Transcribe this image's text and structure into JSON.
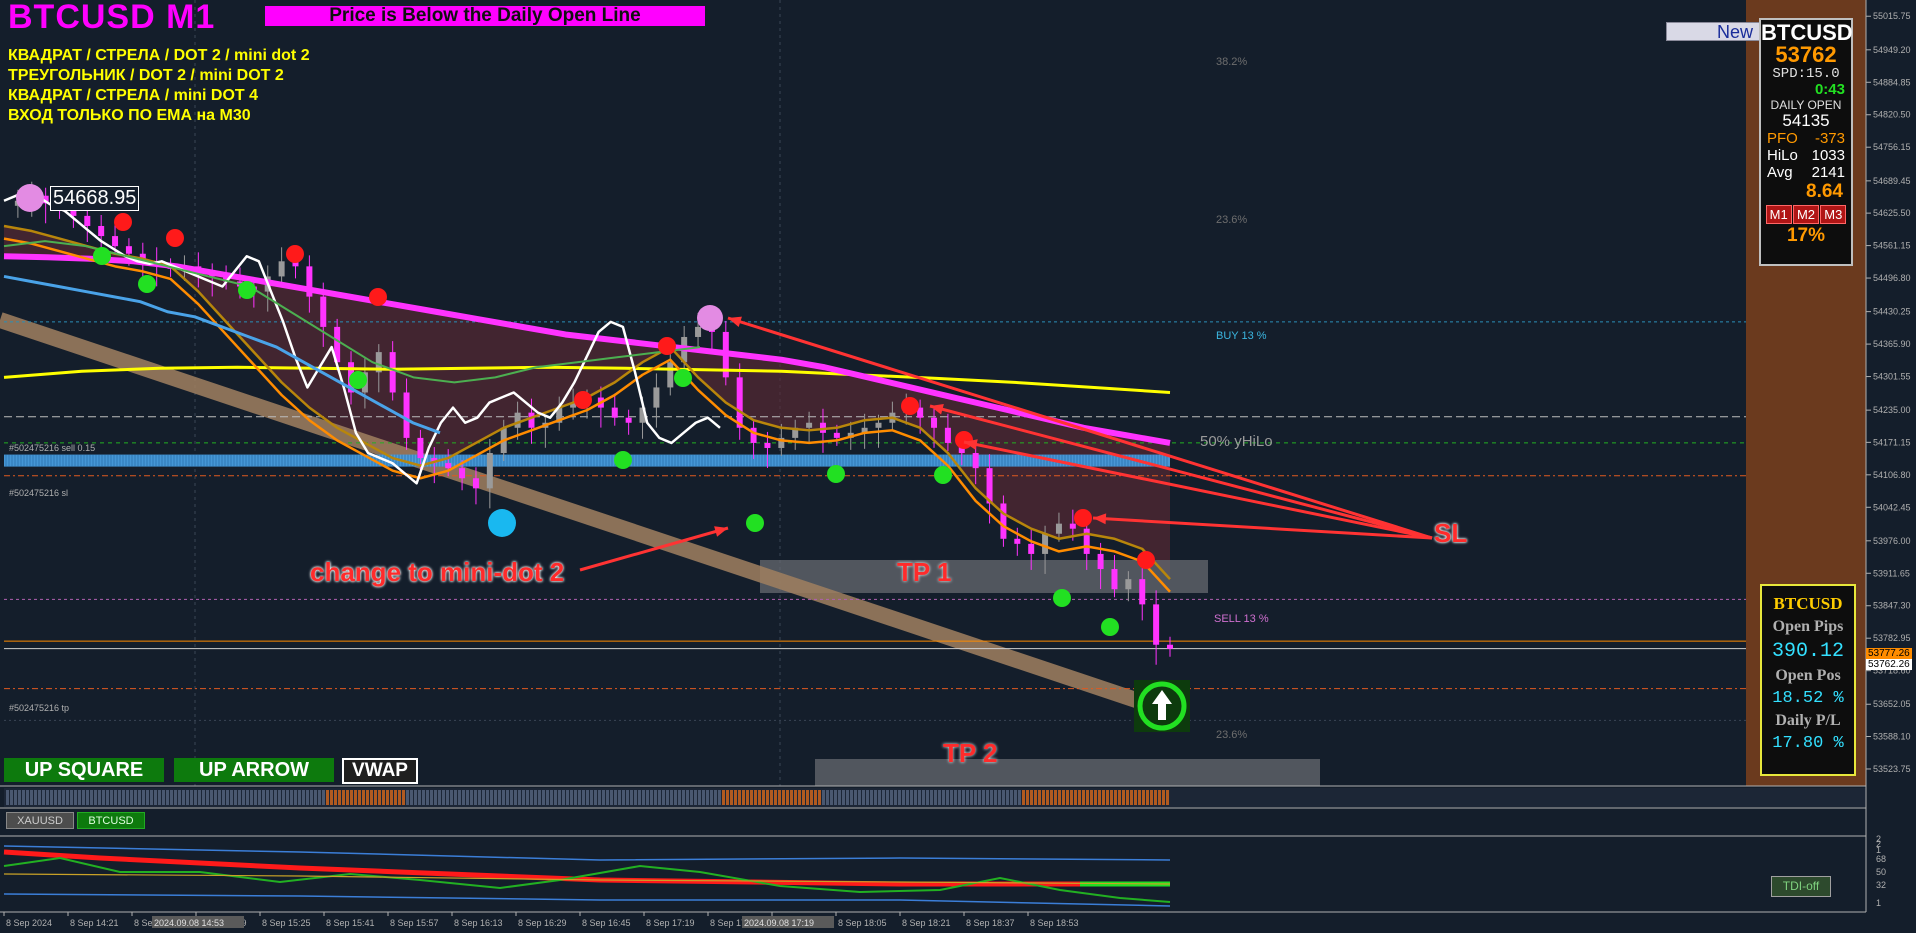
{
  "header": {
    "symbol_title": "BTCUSD M1",
    "banner": "Price is Below the Daily Open Line",
    "new_button": "New",
    "price_tag": "54668.95"
  },
  "strategy_notes": [
    "КВАДРАТ / СТРЕЛА / DOT 2 / mini dot 2",
    "ТРЕУГОЛЬНИК / DOT 2 / mini DOT 2",
    "КВАДРАТ / СТРЕЛА /  mini DOT 4",
    "ВХОД ТОЛЬКО ПО ЕМА на  M30"
  ],
  "info_panel": {
    "symbol": "BTCUSD",
    "price": "53762",
    "spread": "SPD:15.0",
    "timer": "0:43",
    "daily_open_label": "DAILY OPEN",
    "daily_open": "54135",
    "pfo_label": "PFO",
    "pfo": "-373",
    "hilo_label": "HiLo",
    "hilo": "1033",
    "avg_label": "Avg",
    "avg": "2141",
    "ratio": "8.64",
    "tf_buttons": [
      "M1",
      "M2",
      "M3"
    ],
    "percent": "17%"
  },
  "pips_panel": {
    "symbol": "BTCUSD",
    "open_pips_label": "Open Pips",
    "open_pips": "390.12",
    "open_pos_label": "Open Pos",
    "open_pos": "18.52 %",
    "daily_pl_label": "Daily P/L",
    "daily_pl": "17.80 %"
  },
  "buttons": {
    "up_square": "UP SQUARE",
    "up_arrow": "UP ARROW",
    "vwap": "VWAP",
    "tdi": "TDI-off"
  },
  "symbol_tabs": [
    "XAUUSD",
    "BTCUSD"
  ],
  "annotations": {
    "change_note": "change to mini-dot 2",
    "sl": "SL",
    "tp1": "TP 1",
    "tp2": "TP 2"
  },
  "level_labels": {
    "fib_top": "38.2%",
    "fib_mid": "23.6%",
    "buy": "BUY 13 %",
    "hilo50": "50% yHiLo",
    "sell": "SELL 13 %",
    "fib_bottom": "23.6%",
    "order_sell": "#502475216 sell 0.15",
    "order_sl": "#502475216 sl",
    "order_tp": "#502475216 tp",
    "price_box_1": "53777.26",
    "price_box_2": "53762.26"
  },
  "colors": {
    "background": "#141e2b",
    "bear_candles": "#ff33ff",
    "bull_candles": "#9a9a9a",
    "ema_fast": "#ff8c00",
    "ema_mid": "#b8860b",
    "ema_slow": "#ff33ff",
    "ema_200": "#ffff00",
    "daily_open_band": "#4aa3e8",
    "trendline": "#a08060",
    "dot_red": "#ff1a1a",
    "dot_green": "#22e022",
    "dot_violet": "#e38be3"
  },
  "chart_data": {
    "type": "line",
    "title": "BTCUSD M1",
    "x_ticks": [
      "8 Sep 2024",
      "8 Sep 14:21",
      "8 Sep 14:53",
      "8 Sep 15:09",
      "8 Sep 15:25",
      "8 Sep 15:41",
      "8 Sep 15:57",
      "8 Sep 16:13",
      "8 Sep 16:29",
      "8 Sep 16:45",
      "8 Sep 17:19",
      "8 Sep 17:33",
      "8 Sep 17:49",
      "8 Sep 18:05",
      "8 Sep 18:21",
      "8 Sep 18:37",
      "8 Sep 18:53"
    ],
    "x_tick_highlights": [
      "2024.09.08 14:53",
      "2024.09.08 17:19"
    ],
    "y_ticks": [
      55015.75,
      54949.2,
      54884.85,
      54820.5,
      54756.15,
      54689.45,
      54625.5,
      54561.15,
      54496.8,
      54430.25,
      54365.9,
      54301.55,
      54235.0,
      54171.15,
      54106.8,
      54042.45,
      53976.0,
      53911.65,
      53847.3,
      53782.95,
      53718.6,
      53652.05,
      53588.1,
      53523.75
    ],
    "ylim": [
      53490,
      55040
    ],
    "price_series": [
      54640,
      54650,
      54660,
      54645,
      54630,
      54620,
      54600,
      54580,
      54560,
      54545,
      54530,
      54520,
      54515,
      54520,
      54510,
      54500,
      54490,
      54480,
      54470,
      54500,
      54530,
      54520,
      54460,
      54400,
      54330,
      54270,
      54310,
      54350,
      54270,
      54180,
      54140,
      54130,
      54120,
      54100,
      54080,
      54150,
      54200,
      54230,
      54200,
      54210,
      54240,
      54250,
      54260,
      54240,
      54220,
      54210,
      54240,
      54280,
      54330,
      54380,
      54400,
      54390,
      54300,
      54200,
      54170,
      54160,
      54180,
      54200,
      54210,
      54190,
      54180,
      54190,
      54200,
      54210,
      54230,
      54240,
      54220,
      54200,
      54170,
      54150,
      54120,
      54050,
      53980,
      53970,
      53950,
      53990,
      54010,
      54000,
      53950,
      53920,
      53880,
      53900,
      53850,
      53770,
      53762
    ],
    "ema_fast": [
      54600,
      54590,
      54575,
      54560,
      54545,
      54535,
      54520,
      54470,
      54410,
      54350,
      54290,
      54240,
      54200,
      54170,
      54140,
      54125,
      54140,
      54170,
      54200,
      54220,
      54240,
      54260,
      54290,
      54330,
      54360,
      54300,
      54250,
      54215,
      54200,
      54195,
      54200,
      54215,
      54220,
      54200,
      54150,
      54080,
      54030,
      54000,
      53980,
      53990,
      53980,
      53960,
      53900
    ],
    "ema_slow": [
      54540,
      54538,
      54535,
      54530,
      54520,
      54505,
      54490,
      54475,
      54460,
      54445,
      54430,
      54415,
      54400,
      54385,
      54375,
      54365,
      54355,
      54345,
      54335,
      54320,
      54300,
      54280,
      54260,
      54240,
      54220,
      54200,
      54185,
      54170
    ],
    "ema_200": [
      54300,
      54312,
      54318,
      54320,
      54318,
      54316,
      54318,
      54320,
      54318,
      54315,
      54312,
      54305,
      54298,
      54290,
      54280,
      54270
    ],
    "levels": {
      "daily_open": 54135,
      "buy_level": 54410,
      "hilo_50": 54222,
      "entry_sell": 54170,
      "stop_loss": 54105,
      "sell_level": 53860,
      "current_price_1": 53777.26,
      "current_price_2": 53762.26,
      "take_profit": 53683
    },
    "grid": false
  }
}
